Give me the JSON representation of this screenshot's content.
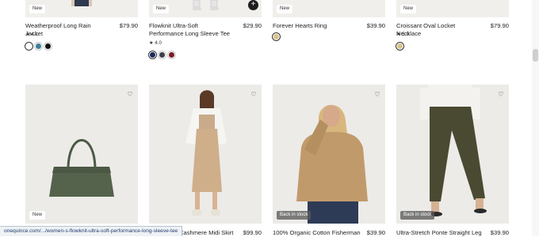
{
  "products_top": [
    {
      "title": "Weatherproof Long Rain Jacket",
      "price": "$79.90",
      "badge": "New",
      "rating_star": "★",
      "rating": "4.1",
      "swatches": [
        "#ffffff",
        "#3f7f9a",
        "#111111"
      ],
      "selected_swatch": 0
    },
    {
      "title": "Flowknit Ultra-Soft Performance Long Sleeve Tee",
      "price": "$29.90",
      "badge": "New",
      "rating_star": "★",
      "rating": "4.0",
      "swatches": [
        "#1d2a5a",
        "#3b3f4a",
        "#7a1c27"
      ],
      "selected_swatch": 0,
      "quick_add": "+"
    },
    {
      "title": "Forever Hearts Ring",
      "price": "$39.90",
      "badge": "New",
      "swatches": [
        "#d8c38a"
      ],
      "selected_swatch": 0
    },
    {
      "title": "Croissant Oval Locket Necklace",
      "price": "$79.90",
      "badge": "New",
      "rating_star": "★",
      "rating": "5.0",
      "swatches": [
        "#d8c38a"
      ],
      "selected_swatch": 0
    }
  ],
  "products_bottom": [
    {
      "title": "",
      "price": "",
      "badge": "New",
      "wishlist_icon": "♡",
      "image": "green-tote-bag"
    },
    {
      "title": "Cashmere Midi Skirt",
      "price": "$99.90",
      "badge": "",
      "wishlist_icon": "♡",
      "image": "model-knit-set"
    },
    {
      "title": "100% Organic Cotton Fisherman",
      "price": "$39.90",
      "badge": "Back in stock",
      "wishlist_icon": "♡",
      "image": "model-tan-sweater"
    },
    {
      "title": "Ultra-Stretch Ponte Straight Leg",
      "price": "$39.90",
      "badge": "Back in stock",
      "wishlist_icon": "♡",
      "image": "model-olive-pants"
    }
  ],
  "status_bar": {
    "url": "onequince.com/.../women-s-flowknit-ultra-soft-performance-long-sleeve-tee"
  },
  "icons": {
    "wishlist": "heart-icon",
    "quick_add": "plus-icon",
    "rating": "star-icon"
  }
}
